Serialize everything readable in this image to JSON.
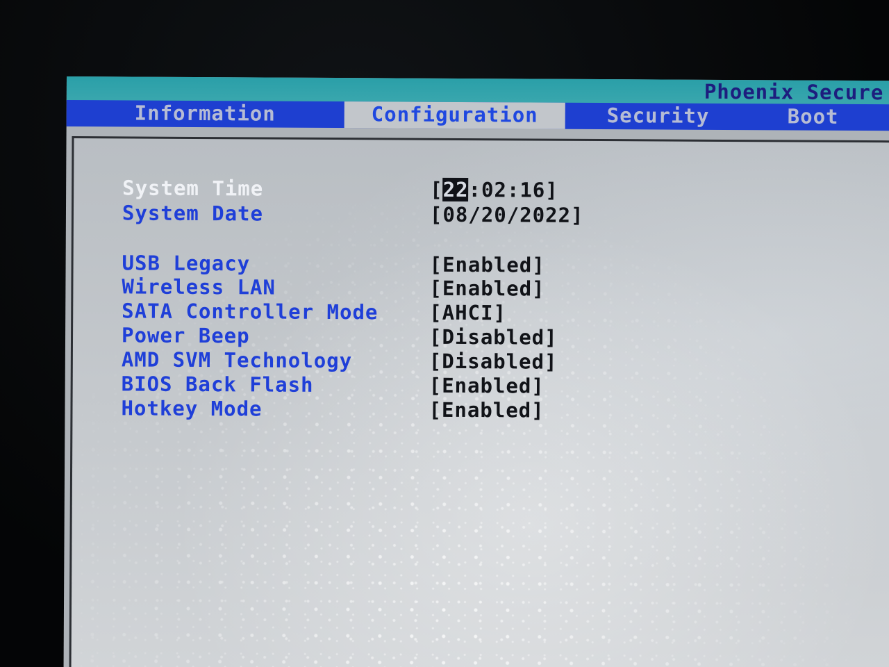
{
  "header": {
    "vendor_title": "Phoenix Secure"
  },
  "tabs": [
    {
      "label": "Information",
      "active": false
    },
    {
      "label": "Configuration",
      "active": true
    },
    {
      "label": "Security",
      "active": false
    },
    {
      "label": "Boot",
      "active": false
    }
  ],
  "settings": {
    "system_time": {
      "label": "System Time",
      "hour": "22",
      "rest": ":02:16"
    },
    "system_date": {
      "label": "System Date",
      "value": "08/20/2022"
    },
    "items": [
      {
        "label": "USB Legacy",
        "value": "[Enabled]"
      },
      {
        "label": "Wireless LAN",
        "value": "[Enabled]"
      },
      {
        "label": "SATA Controller Mode",
        "value": "[AHCI]"
      },
      {
        "label": "Power Beep",
        "value": "[Disabled]"
      },
      {
        "label": "AMD SVM Technology",
        "value": "[Disabled]"
      },
      {
        "label": "BIOS Back Flash",
        "value": "[Enabled]"
      },
      {
        "label": "Hotkey Mode",
        "value": "[Enabled]"
      }
    ]
  },
  "colors": {
    "title_bar": "#2a9fa8",
    "tab_bar": "#1e3fd0",
    "label_blue": "#1f3fd8",
    "panel_gray": "#c5c9cd"
  }
}
